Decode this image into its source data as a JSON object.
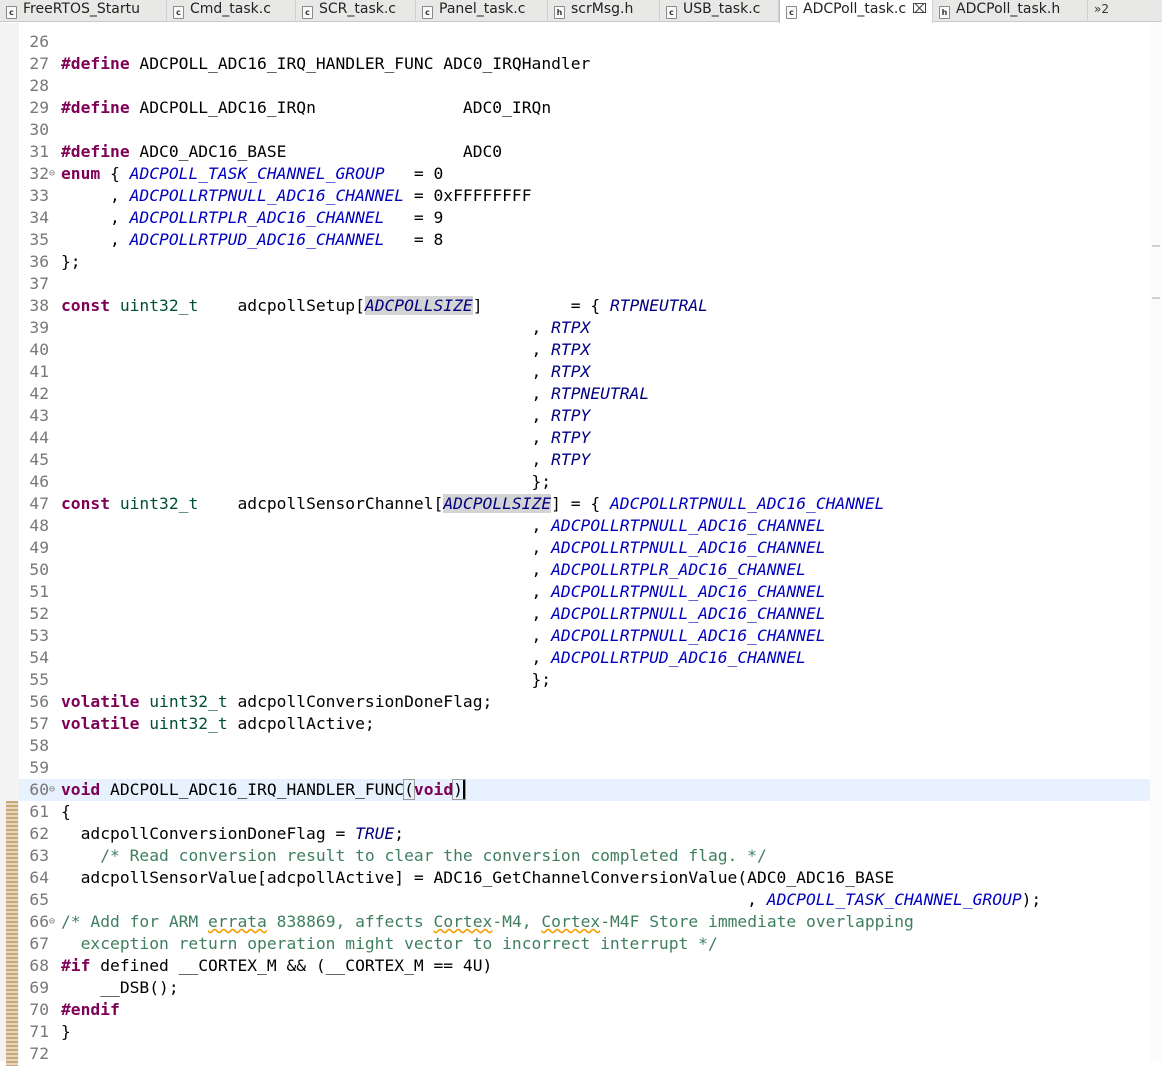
{
  "tabs": [
    {
      "icon": "c",
      "label": "FreeRTOS_Startu"
    },
    {
      "icon": "c",
      "label": "Cmd_task.c"
    },
    {
      "icon": "c",
      "label": "SCR_task.c"
    },
    {
      "icon": "c",
      "label": "Panel_task.c"
    },
    {
      "icon": "h",
      "label": "scrMsg.h"
    },
    {
      "icon": "c",
      "label": "USB_task.c"
    },
    {
      "icon": "c",
      "label": "ADCPoll_task.c",
      "active": true
    },
    {
      "icon": "h",
      "label": "ADCPoll_task.h"
    }
  ],
  "tab_close": "⌧",
  "tab_overflow": "»2",
  "colors": {
    "keyword": "#7f0055",
    "type": "#005032",
    "enum": "#0000c0",
    "macro": "#000080",
    "comment": "#3f7f5f",
    "current_line": "#e8f2fe"
  },
  "lines": [
    {
      "n": "26",
      "cur": false,
      "fold": "",
      "toks": []
    },
    {
      "n": "27",
      "cur": false,
      "fold": "",
      "toks": [
        {
          "t": "#define",
          "c": "pp"
        },
        {
          "t": " ADCPOLL_ADC16_IRQ_HANDLER_FUNC ADC0_IRQHandler"
        }
      ]
    },
    {
      "n": "28",
      "cur": false,
      "fold": "",
      "toks": []
    },
    {
      "n": "29",
      "cur": false,
      "fold": "",
      "toks": [
        {
          "t": "#define",
          "c": "pp"
        },
        {
          "t": " ADCPOLL_ADC16_IRQn               ADC0_IRQn"
        }
      ]
    },
    {
      "n": "30",
      "cur": false,
      "fold": "",
      "toks": []
    },
    {
      "n": "31",
      "cur": false,
      "fold": "",
      "toks": [
        {
          "t": "#define",
          "c": "pp"
        },
        {
          "t": " ADC0_ADC16_BASE                  ADC0"
        }
      ]
    },
    {
      "n": "32",
      "cur": false,
      "fold": "⊖",
      "toks": [
        {
          "t": "enum",
          "c": "kw"
        },
        {
          "t": " { "
        },
        {
          "t": "ADCPOLL_TASK_CHANNEL_GROUP",
          "c": "en"
        },
        {
          "t": "   = 0"
        }
      ]
    },
    {
      "n": "33",
      "cur": false,
      "fold": "",
      "toks": [
        {
          "t": "     , "
        },
        {
          "t": "ADCPOLLRTPNULL_ADC16_CHANNEL",
          "c": "en"
        },
        {
          "t": " = 0xFFFFFFFF"
        }
      ]
    },
    {
      "n": "34",
      "cur": false,
      "fold": "",
      "toks": [
        {
          "t": "     , "
        },
        {
          "t": "ADCPOLLRTPLR_ADC16_CHANNEL",
          "c": "en"
        },
        {
          "t": "   = 9"
        }
      ]
    },
    {
      "n": "35",
      "cur": false,
      "fold": "",
      "toks": [
        {
          "t": "     , "
        },
        {
          "t": "ADCPOLLRTPUD_ADC16_CHANNEL",
          "c": "en"
        },
        {
          "t": "   = 8"
        }
      ]
    },
    {
      "n": "36",
      "cur": false,
      "fold": "",
      "toks": [
        {
          "t": "};"
        }
      ]
    },
    {
      "n": "37",
      "cur": false,
      "fold": "",
      "toks": []
    },
    {
      "n": "38",
      "cur": false,
      "fold": "",
      "toks": [
        {
          "t": "const",
          "c": "kw"
        },
        {
          "t": " "
        },
        {
          "t": "uint32_t",
          "c": "ty"
        },
        {
          "t": "    adcpollSetup["
        },
        {
          "t": "ADCPOLLSIZE",
          "c": "mac hl"
        },
        {
          "t": "]         = { "
        },
        {
          "t": "RTPNEUTRAL",
          "c": "mac"
        }
      ]
    },
    {
      "n": "39",
      "cur": false,
      "fold": "",
      "toks": [
        {
          "t": "                                                , "
        },
        {
          "t": "RTPX",
          "c": "mac"
        }
      ]
    },
    {
      "n": "40",
      "cur": false,
      "fold": "",
      "toks": [
        {
          "t": "                                                , "
        },
        {
          "t": "RTPX",
          "c": "mac"
        }
      ]
    },
    {
      "n": "41",
      "cur": false,
      "fold": "",
      "toks": [
        {
          "t": "                                                , "
        },
        {
          "t": "RTPX",
          "c": "mac"
        }
      ]
    },
    {
      "n": "42",
      "cur": false,
      "fold": "",
      "toks": [
        {
          "t": "                                                , "
        },
        {
          "t": "RTPNEUTRAL",
          "c": "mac"
        }
      ]
    },
    {
      "n": "43",
      "cur": false,
      "fold": "",
      "toks": [
        {
          "t": "                                                , "
        },
        {
          "t": "RTPY",
          "c": "mac"
        }
      ]
    },
    {
      "n": "44",
      "cur": false,
      "fold": "",
      "toks": [
        {
          "t": "                                                , "
        },
        {
          "t": "RTPY",
          "c": "mac"
        }
      ]
    },
    {
      "n": "45",
      "cur": false,
      "fold": "",
      "toks": [
        {
          "t": "                                                , "
        },
        {
          "t": "RTPY",
          "c": "mac"
        }
      ]
    },
    {
      "n": "46",
      "cur": false,
      "fold": "",
      "toks": [
        {
          "t": "                                                };"
        }
      ]
    },
    {
      "n": "47",
      "cur": false,
      "fold": "",
      "toks": [
        {
          "t": "const",
          "c": "kw"
        },
        {
          "t": " "
        },
        {
          "t": "uint32_t",
          "c": "ty"
        },
        {
          "t": "    adcpollSensorChannel["
        },
        {
          "t": "ADCPOLLSIZE",
          "c": "mac hl"
        },
        {
          "t": "] = { "
        },
        {
          "t": "ADCPOLLRTPNULL_ADC16_CHANNEL",
          "c": "en"
        }
      ]
    },
    {
      "n": "48",
      "cur": false,
      "fold": "",
      "toks": [
        {
          "t": "                                                , "
        },
        {
          "t": "ADCPOLLRTPNULL_ADC16_CHANNEL",
          "c": "en"
        }
      ]
    },
    {
      "n": "49",
      "cur": false,
      "fold": "",
      "toks": [
        {
          "t": "                                                , "
        },
        {
          "t": "ADCPOLLRTPNULL_ADC16_CHANNEL",
          "c": "en"
        }
      ]
    },
    {
      "n": "50",
      "cur": false,
      "fold": "",
      "toks": [
        {
          "t": "                                                , "
        },
        {
          "t": "ADCPOLLRTPLR_ADC16_CHANNEL",
          "c": "en"
        }
      ]
    },
    {
      "n": "51",
      "cur": false,
      "fold": "",
      "toks": [
        {
          "t": "                                                , "
        },
        {
          "t": "ADCPOLLRTPNULL_ADC16_CHANNEL",
          "c": "en"
        }
      ]
    },
    {
      "n": "52",
      "cur": false,
      "fold": "",
      "toks": [
        {
          "t": "                                                , "
        },
        {
          "t": "ADCPOLLRTPNULL_ADC16_CHANNEL",
          "c": "en"
        }
      ]
    },
    {
      "n": "53",
      "cur": false,
      "fold": "",
      "toks": [
        {
          "t": "                                                , "
        },
        {
          "t": "ADCPOLLRTPNULL_ADC16_CHANNEL",
          "c": "en"
        }
      ]
    },
    {
      "n": "54",
      "cur": false,
      "fold": "",
      "toks": [
        {
          "t": "                                                , "
        },
        {
          "t": "ADCPOLLRTPUD_ADC16_CHANNEL",
          "c": "en"
        }
      ]
    },
    {
      "n": "55",
      "cur": false,
      "fold": "",
      "toks": [
        {
          "t": "                                                };"
        }
      ]
    },
    {
      "n": "56",
      "cur": false,
      "fold": "",
      "toks": [
        {
          "t": "volatile",
          "c": "kw"
        },
        {
          "t": " "
        },
        {
          "t": "uint32_t",
          "c": "ty"
        },
        {
          "t": " adcpollConversionDoneFlag;"
        }
      ]
    },
    {
      "n": "57",
      "cur": false,
      "fold": "",
      "toks": [
        {
          "t": "volatile",
          "c": "kw"
        },
        {
          "t": " "
        },
        {
          "t": "uint32_t",
          "c": "ty"
        },
        {
          "t": " adcpollActive;"
        }
      ]
    },
    {
      "n": "58",
      "cur": false,
      "fold": "",
      "toks": []
    },
    {
      "n": "59",
      "cur": false,
      "fold": "",
      "toks": []
    },
    {
      "n": "60",
      "cur": true,
      "fold": "⊖",
      "toks": [
        {
          "t": "void",
          "c": "kw"
        },
        {
          "t": " ADCPOLL_ADC16_IRQ_HANDLER_FUNC"
        },
        {
          "t": "(",
          "c": "paren"
        },
        {
          "t": "void",
          "c": "kw"
        },
        {
          "t": ")",
          "c": "paren cursor"
        }
      ]
    },
    {
      "n": "61",
      "cur": false,
      "fold": "",
      "toks": [
        {
          "t": "{"
        }
      ]
    },
    {
      "n": "62",
      "cur": false,
      "fold": "",
      "toks": [
        {
          "t": "  adcpollConversionDoneFlag = "
        },
        {
          "t": "TRUE",
          "c": "mac"
        },
        {
          "t": ";"
        }
      ]
    },
    {
      "n": "63",
      "cur": false,
      "fold": "",
      "toks": [
        {
          "t": "    "
        },
        {
          "t": "/* Read conversion result to clear the conversion completed flag. */",
          "c": "cm"
        }
      ]
    },
    {
      "n": "64",
      "cur": false,
      "fold": "",
      "toks": [
        {
          "t": "  adcpollSensorValue[adcpollActive] = ADC16_GetChannelConversionValue(ADC0_ADC16_BASE"
        }
      ]
    },
    {
      "n": "65",
      "cur": false,
      "fold": "",
      "toks": [
        {
          "t": "                                                                      , "
        },
        {
          "t": "ADCPOLL_TASK_CHANNEL_GROUP",
          "c": "en"
        },
        {
          "t": ");"
        }
      ]
    },
    {
      "n": "66",
      "cur": false,
      "fold": "⊖",
      "toks": [
        {
          "t": "/* Add for ARM ",
          "c": "cm"
        },
        {
          "t": "errata",
          "c": "cm sq"
        },
        {
          "t": " 838869, affects ",
          "c": "cm"
        },
        {
          "t": "Cortex",
          "c": "cm sq"
        },
        {
          "t": "-M4, ",
          "c": "cm"
        },
        {
          "t": "Cortex",
          "c": "cm sq"
        },
        {
          "t": "-M4F Store immediate overlapping",
          "c": "cm"
        }
      ]
    },
    {
      "n": "67",
      "cur": false,
      "fold": "",
      "toks": [
        {
          "t": "  exception return operation might vector to incorrect interrupt */",
          "c": "cm"
        }
      ]
    },
    {
      "n": "68",
      "cur": false,
      "fold": "",
      "toks": [
        {
          "t": "#if",
          "c": "pp"
        },
        {
          "t": " defined __CORTEX_M && (__CORTEX_M == 4U)"
        }
      ]
    },
    {
      "n": "69",
      "cur": false,
      "fold": "",
      "toks": [
        {
          "t": "    __DSB();"
        }
      ]
    },
    {
      "n": "70",
      "cur": false,
      "fold": "",
      "toks": [
        {
          "t": "#endif",
          "c": "pp"
        }
      ]
    },
    {
      "n": "71",
      "cur": false,
      "fold": "",
      "toks": [
        {
          "t": "}"
        }
      ]
    },
    {
      "n": "72",
      "cur": false,
      "fold": "",
      "toks": []
    }
  ]
}
